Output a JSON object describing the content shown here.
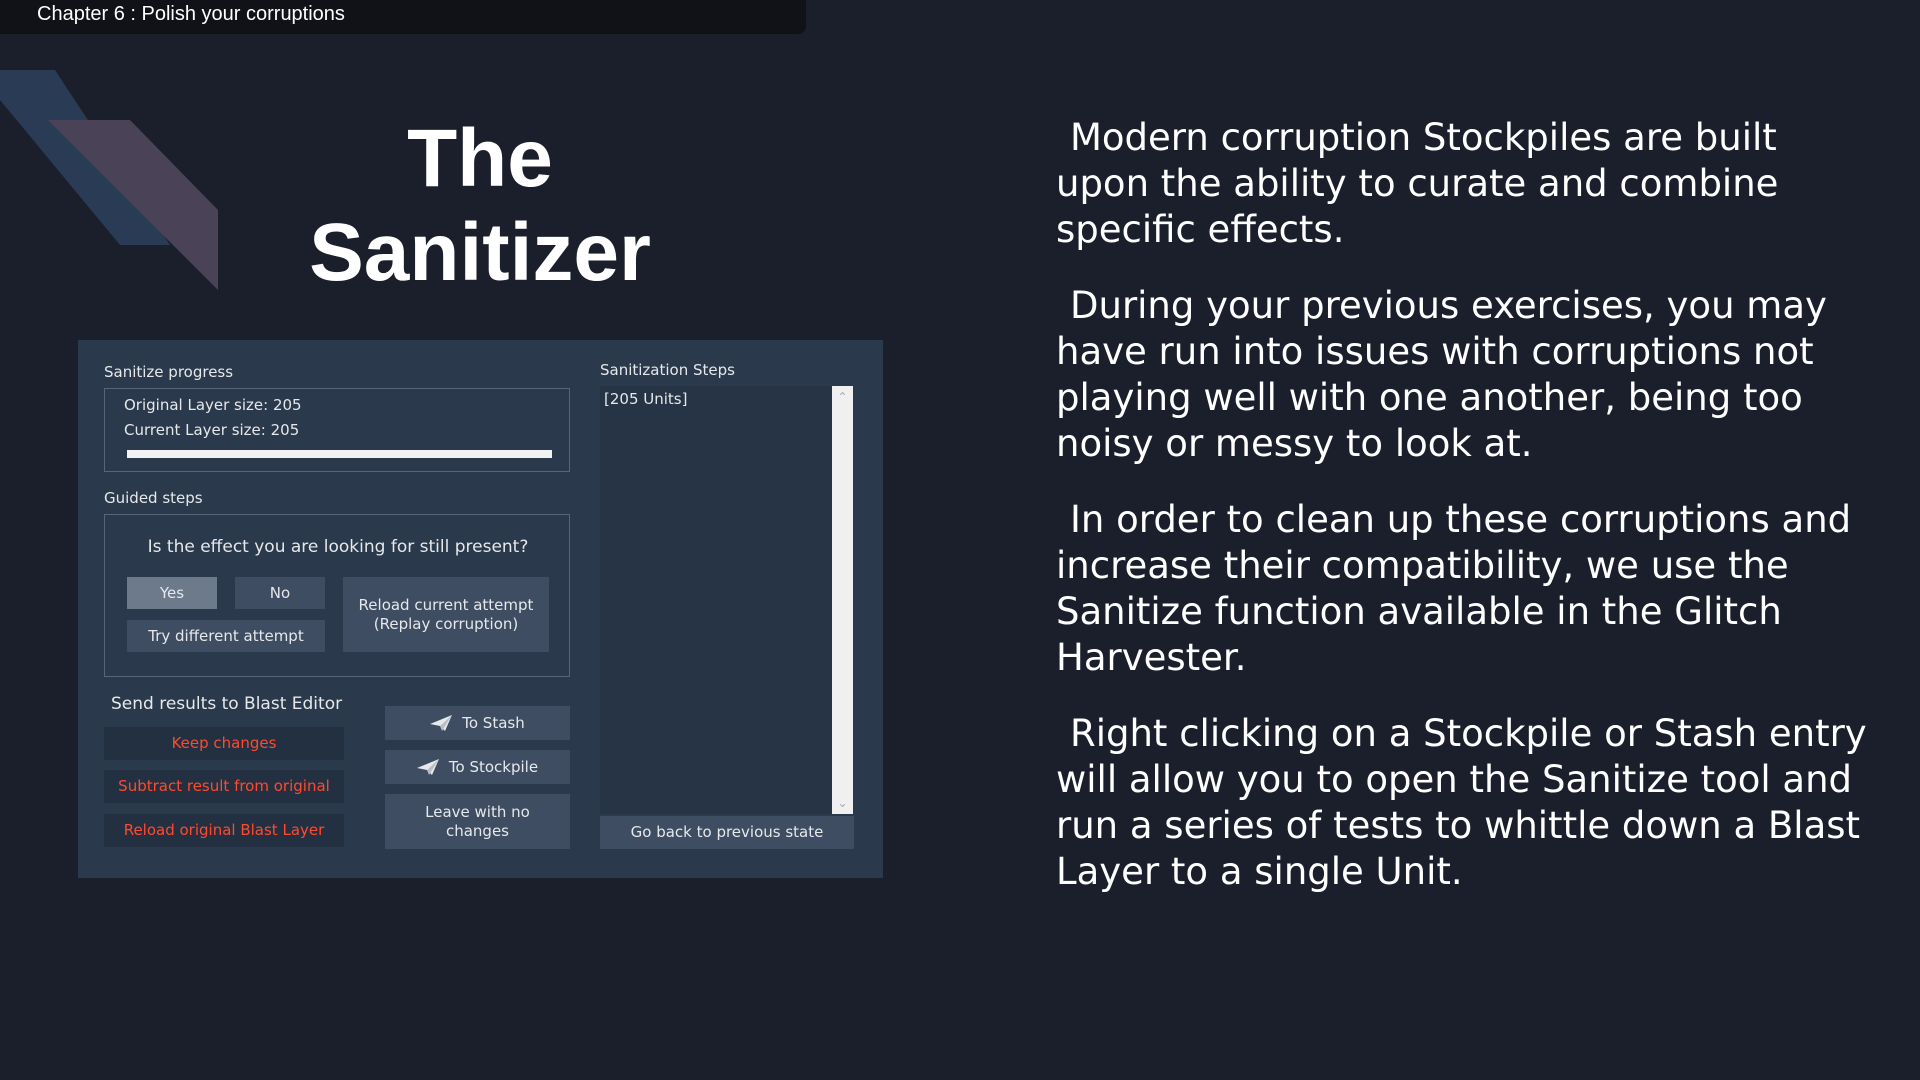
{
  "slide": {
    "chapter_title": "Chapter 6 : Polish your corruptions",
    "title_line1": "The",
    "title_line2": "Sanitizer",
    "paragraphs": [
      "Modern corruption Stockpiles are built upon the ability to curate and combine specific effects.",
      "During your previous exercises, you may have run into issues with corruptions not playing well with one another, being too noisy or messy to look at.",
      "In order to clean up these corruptions and increase their compatibility, we use the Sanitize function available in the Glitch Harvester.",
      "Right clicking on a Stockpile or Stash entry will allow you to open the Sanitize tool and run a series of tests to whittle down a Blast Layer to a single Unit."
    ]
  },
  "sanitizer": {
    "progress": {
      "label": "Sanitize progress",
      "original_size": "Original Layer size: 205",
      "current_size": "Current Layer size: 205",
      "fill_fraction": 1.0
    },
    "guided": {
      "label": "Guided steps",
      "question": "Is the effect you are looking for still present?",
      "yes": "Yes",
      "no": "No",
      "try_different": "Try different attempt",
      "reload_line1": "Reload current attempt",
      "reload_line2": "(Replay corruption)"
    },
    "send": {
      "label": "Send results to Blast Editor",
      "keep": "Keep changes",
      "subtract": "Subtract result from original",
      "reload_original": "Reload original Blast Layer",
      "to_stash": "To Stash",
      "to_stockpile": "To Stockpile",
      "leave_line1": "Leave with no",
      "leave_line2": "changes"
    },
    "steps": {
      "label": "Sanitization Steps",
      "items": [
        "[205 Units]"
      ],
      "go_back": "Go back to previous state"
    }
  },
  "colors": {
    "background": "#1b1f2b",
    "panel": "#2a394b",
    "button": "#3e4d62",
    "danger_text": "#ff4a2e"
  },
  "icons": [
    "paper-plane-icon",
    "scroll-up-icon",
    "scroll-down-icon"
  ]
}
